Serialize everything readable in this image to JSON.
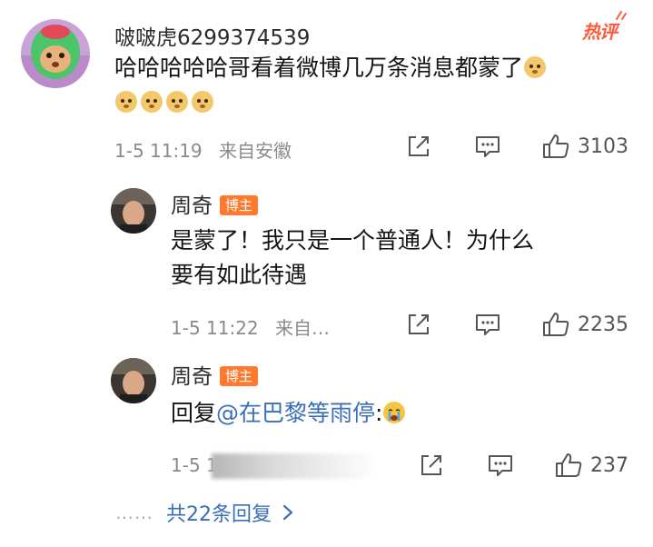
{
  "comment": {
    "username": "啵啵虎6299374539",
    "hot_label": "热评",
    "text": "哈哈哈哈哈哥看着微博几万条消息都蒙了",
    "timestamp": "1-5 11:19",
    "location": "来自安徽",
    "likes": "3103"
  },
  "replies": [
    {
      "username": "周奇",
      "badge": "博主",
      "text_line1": "是蒙了！我只是一个普通人！为什么",
      "text_line2": "要有如此待遇",
      "timestamp": "1-5 11:22",
      "location": "来自…",
      "likes": "2235"
    },
    {
      "username": "周奇",
      "badge": "博主",
      "reply_prefix": "回复",
      "mention": "@在巴黎等雨停",
      "colon": ":",
      "timestamp": "1-5 1",
      "likes": "237"
    }
  ],
  "more_replies": {
    "dots": "……",
    "label": "共22条回复"
  },
  "colors": {
    "accent_blue": "#3a6fb7",
    "hot_red": "#ff5a3d",
    "badge_orange": "#ff7a2e",
    "meta_gray": "#8a8a8a"
  }
}
